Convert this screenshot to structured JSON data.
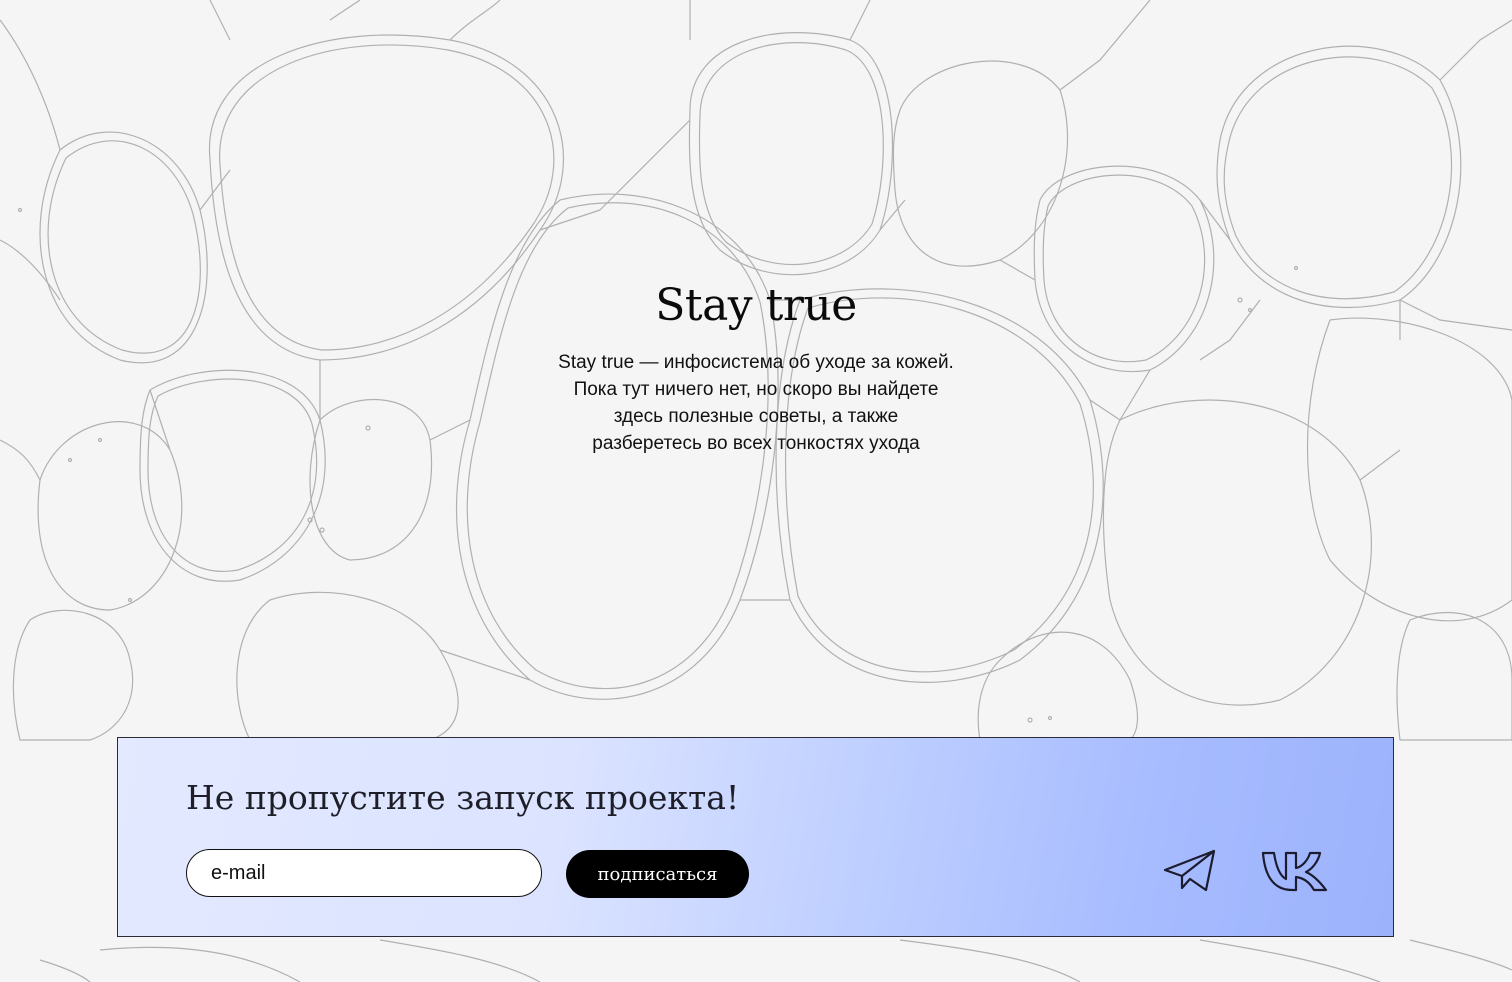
{
  "hero": {
    "title": "Stay true",
    "description_lines": [
      "Stay true — инфосистема об уходе за кожей.",
      "Пока тут ничего нет, но скоро вы найдете",
      "здесь полезные советы, а также",
      "разберетесь во всех тонкостях ухода"
    ]
  },
  "subscribe": {
    "title": "Не пропустите запуск проекта!",
    "email_placeholder": "e-mail",
    "email_value": "",
    "button_label": "подписаться"
  },
  "social": [
    {
      "icon": "telegram-icon"
    },
    {
      "icon": "vk-icon"
    }
  ],
  "colors": {
    "background": "#f5f5f5",
    "pattern_stroke": "#8a8a8a",
    "banner_gradient_start": "#e3e9ff",
    "banner_gradient_end": "#9cb2fb",
    "button_bg": "#000000",
    "text": "#111111"
  }
}
